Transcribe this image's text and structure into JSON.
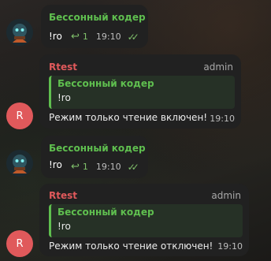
{
  "messages": [
    {
      "sender": "Бессонный кодер",
      "text": "!ro",
      "reply_count": "1",
      "time": "19:10"
    },
    {
      "sender": "Rtest",
      "avatar_letter": "R",
      "role": "admin",
      "quote": {
        "name": "Бессонный кодер",
        "text": "!ro"
      },
      "text": "Режим только чтение включен!",
      "time": "19:10"
    },
    {
      "sender": "Бессонный кодер",
      "text": "!ro",
      "reply_count": "1",
      "time": "19:10"
    },
    {
      "sender": "Rtest",
      "avatar_letter": "R",
      "role": "admin",
      "quote": {
        "name": "Бессонный кодер",
        "text": "!ro"
      },
      "text": "Режим только чтение отключен!",
      "time": "19:10"
    }
  ],
  "colors": {
    "bubble": "#212121",
    "green_name": "#5fbf4f",
    "red_name": "#e0595b",
    "avatar_red": "#e0595b"
  }
}
